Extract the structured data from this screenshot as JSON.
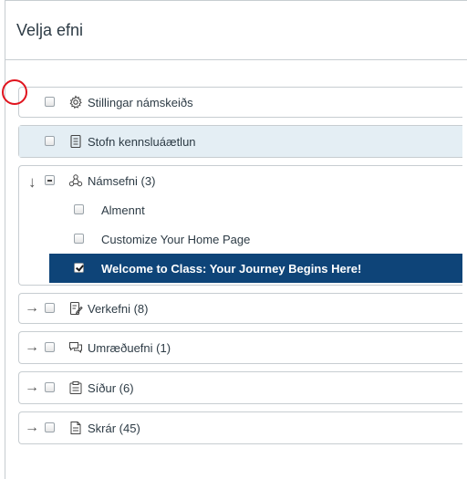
{
  "dialog": {
    "title": "Velja efni"
  },
  "items": [
    {
      "label": "Stillingar námskeiðs",
      "icon": "gear-icon"
    },
    {
      "label": "Stofn kennsluáætlun",
      "icon": "syllabus-icon"
    },
    {
      "label": "Námsefni (3)",
      "icon": "modules-icon",
      "expand": "↓",
      "children": [
        {
          "label": "Almennt"
        },
        {
          "label": "Customize Your Home Page"
        },
        {
          "label": "Welcome to Class: Your Journey Begins Here!"
        }
      ]
    },
    {
      "label": "Verkefni (8)",
      "icon": "assignment-icon",
      "expand": "→"
    },
    {
      "label": "Umræðuefni (1)",
      "icon": "discussion-icon",
      "expand": "→"
    },
    {
      "label": "Síður (6)",
      "icon": "pages-icon",
      "expand": "→"
    },
    {
      "label": "Skrár (45)",
      "icon": "files-icon",
      "expand": "→"
    }
  ],
  "colors": {
    "selected_bg": "#0e4478",
    "highlight_bg": "#e4eef4",
    "annotation_circle": "#e0141e"
  }
}
